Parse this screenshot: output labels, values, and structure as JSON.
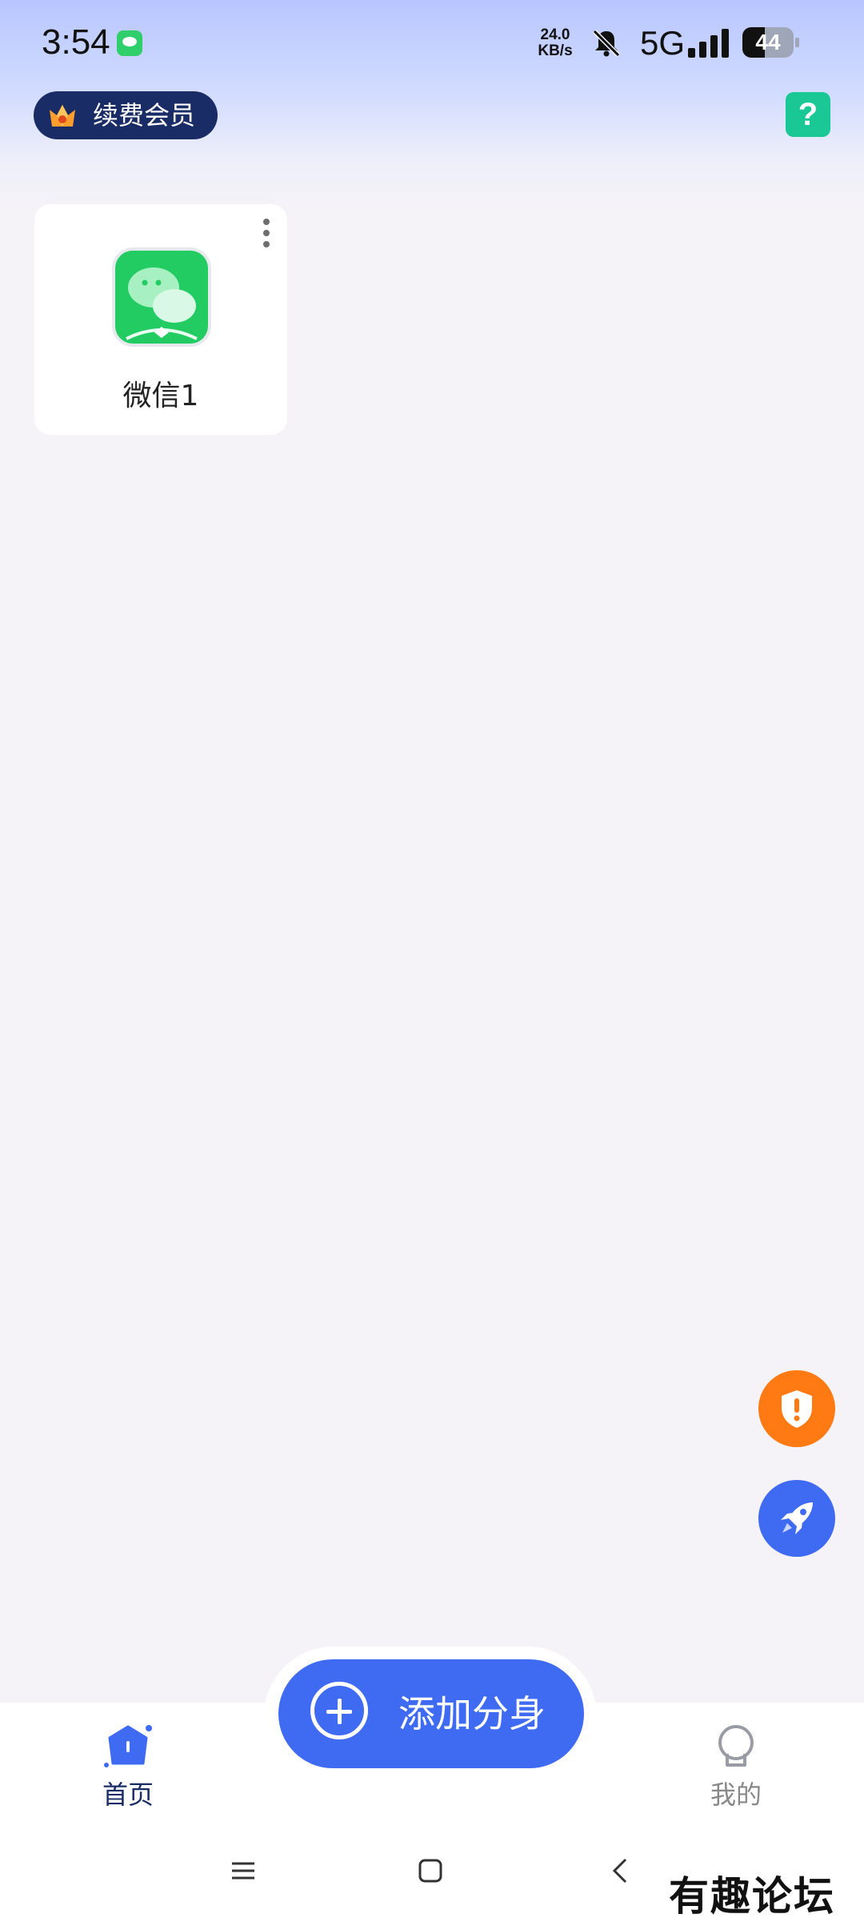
{
  "status_bar": {
    "time": "3:54",
    "net_speed_value": "24.0",
    "net_speed_unit": "KB/s",
    "network": "5G",
    "battery_level": "44",
    "battery_fraction": 0.44
  },
  "header": {
    "member_label": "续费会员",
    "help_label": "?"
  },
  "apps": [
    {
      "name": "微信1",
      "icon": "wechat-clone-icon"
    }
  ],
  "fabs": [
    {
      "icon": "shield-alert-icon",
      "color": "#ff7a12"
    },
    {
      "icon": "rocket-icon",
      "color": "#3f6bf2"
    }
  ],
  "add_button": {
    "label": "添加分身",
    "icon": "plus-circle-icon"
  },
  "bottom_nav": {
    "home_label": "首页",
    "mine_label": "我的"
  },
  "watermark": "有趣论坛",
  "colors": {
    "accent": "#3f6bf2",
    "help": "#19c894",
    "member_pill": "#1a2c66",
    "shield": "#ff7a12"
  }
}
